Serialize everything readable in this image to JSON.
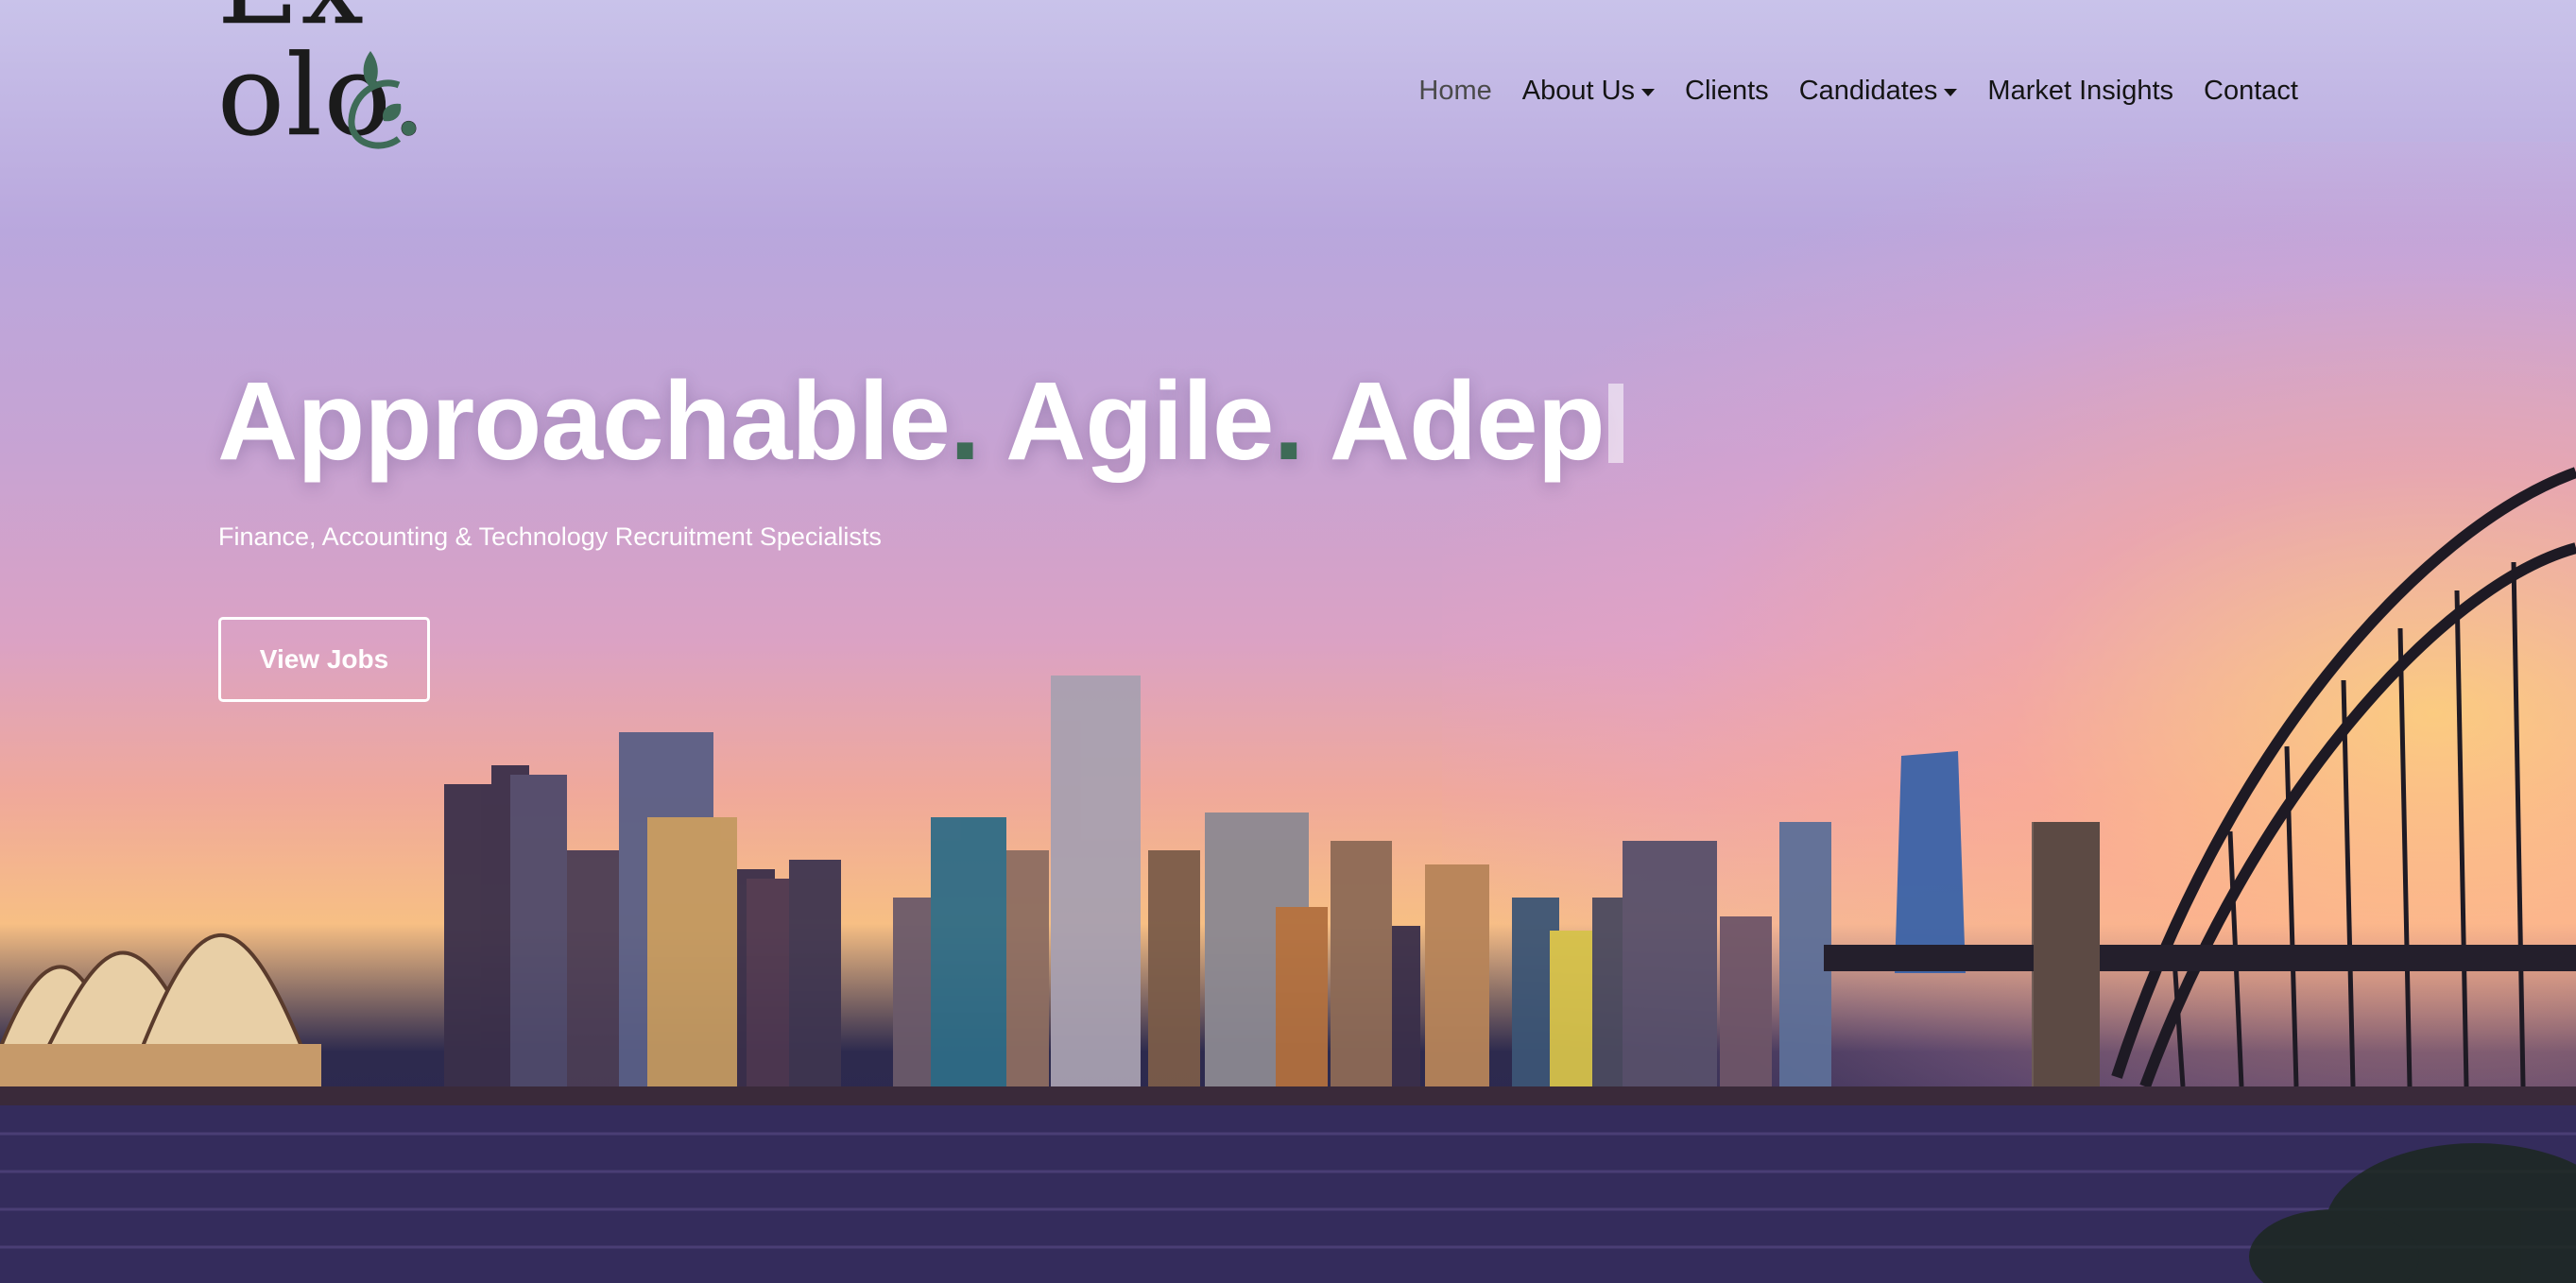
{
  "brand": {
    "logo_text": "Excolo",
    "logo_alt": "Excolo."
  },
  "nav": {
    "items": [
      {
        "label": "Home",
        "active": true,
        "dropdown": false
      },
      {
        "label": "About Us",
        "active": false,
        "dropdown": true
      },
      {
        "label": "Clients",
        "active": false,
        "dropdown": false
      },
      {
        "label": "Candidates",
        "active": false,
        "dropdown": true
      },
      {
        "label": "Market Insights",
        "active": false,
        "dropdown": false
      },
      {
        "label": "Contact",
        "active": false,
        "dropdown": false
      }
    ]
  },
  "hero": {
    "headline_words": [
      "Approachable",
      "Agile",
      "Adep"
    ],
    "subtitle": "Finance, Accounting & Technology Recruitment Specialists",
    "cta_label": "View Jobs"
  },
  "colors": {
    "accent_green": "#3e6b57",
    "text_dark": "#141414",
    "white": "#ffffff"
  },
  "icons": [
    "leaf-icon",
    "caret-down-icon"
  ]
}
